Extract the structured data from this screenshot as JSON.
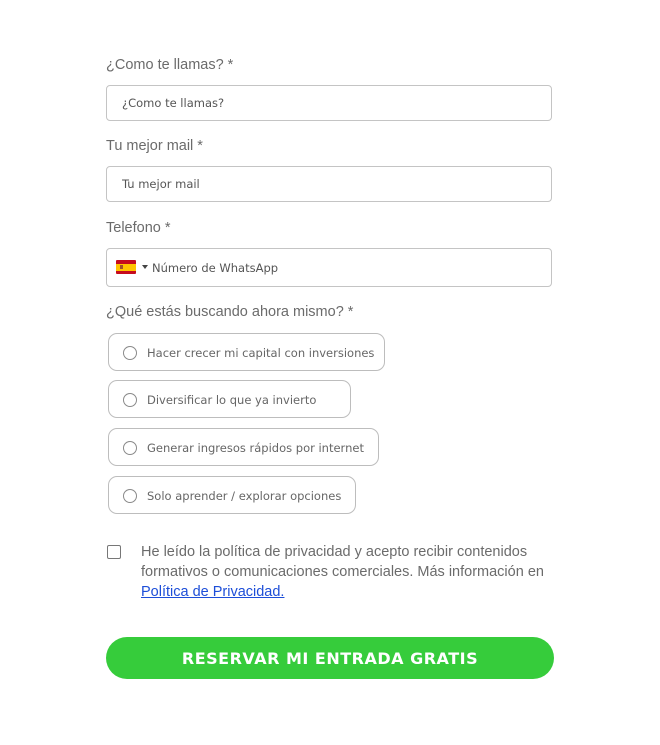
{
  "form": {
    "name_label": "¿Como te llamas? *",
    "name_placeholder": "¿Como te llamas?",
    "email_label": "Tu mejor mail *",
    "email_placeholder": "Tu mejor mail",
    "phone_label": "Telefono *",
    "phone_placeholder": "Número de WhatsApp",
    "phone_country_icon": "spain-flag-icon",
    "goal_label": "¿Qué estás buscando ahora mismo? *",
    "goal_options": [
      {
        "label": "Hacer crecer mi capital con inversiones"
      },
      {
        "label": "Diversificar lo que ya invierto"
      },
      {
        "label": "Generar ingresos rápidos por internet"
      },
      {
        "label": "Solo aprender / explorar opciones"
      }
    ],
    "consent_text": "He leído la política de privacidad y acepto recibir contenidos formativos o comunicaciones comerciales. Más información en ",
    "consent_link": "Política de Privacidad.",
    "submit_label": "RESERVAR MI ENTRADA GRATIS"
  },
  "colors": {
    "accent_green": "#36cc3b",
    "link_blue": "#1d4ed8",
    "label_gray": "#6b6b6b"
  }
}
